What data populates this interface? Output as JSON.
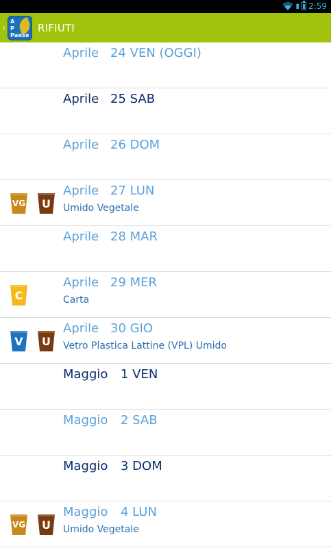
{
  "statusbar": {
    "time": "2:59"
  },
  "actionbar": {
    "logo_line1": "A",
    "logo_line2": "P",
    "logo_line3": "Paese",
    "title": "RIFIUTI"
  },
  "colors": {
    "actionbar": "#a2c30b",
    "date_current": "#5ba2d9",
    "date_other": "#0b2d6b",
    "bin_vg": "#c7891b",
    "bin_u": "#7a3a10",
    "bin_c": "#f6b81a",
    "bin_v": "#1e73be"
  },
  "rows": [
    {
      "month": "Aprile",
      "day": "24 VEN (OGGI)",
      "desc": "",
      "bins": []
    },
    {
      "month": "Aprile",
      "day": "25 SAB",
      "desc": "",
      "bins": []
    },
    {
      "month": "Aprile",
      "day": "26 DOM",
      "desc": "",
      "bins": []
    },
    {
      "month": "Aprile",
      "day": "27 LUN",
      "desc": "Umido Vegetale",
      "bins": [
        "VG",
        "U"
      ]
    },
    {
      "month": "Aprile",
      "day": "28 MAR",
      "desc": "",
      "bins": []
    },
    {
      "month": "Aprile",
      "day": "29 MER",
      "desc": "Carta",
      "bins": [
        "C"
      ]
    },
    {
      "month": "Aprile",
      "day": "30 GIO",
      "desc": "Vetro Plastica Lattine (VPL) Umido",
      "bins": [
        "V",
        "U"
      ]
    },
    {
      "month": "Maggio",
      "day": "1 VEN",
      "desc": "",
      "bins": []
    },
    {
      "month": "Maggio",
      "day": "2 SAB",
      "desc": "",
      "bins": []
    },
    {
      "month": "Maggio",
      "day": "3 DOM",
      "desc": "",
      "bins": []
    },
    {
      "month": "Maggio",
      "day": "4 LUN",
      "desc": "Umido Vegetale",
      "bins": [
        "VG",
        "U"
      ]
    }
  ]
}
